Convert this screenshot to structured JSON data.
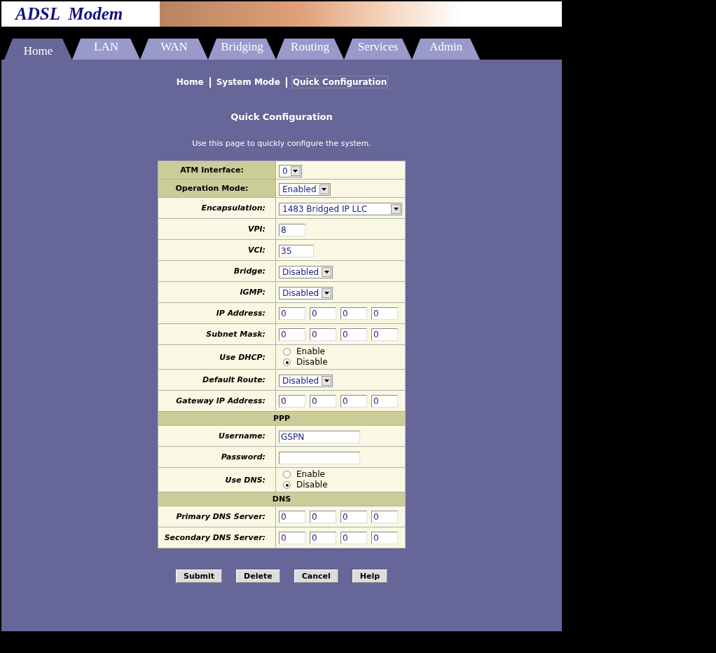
{
  "header": {
    "logo": "ADSL  Modem"
  },
  "tabs": [
    {
      "label": "Home",
      "selected": true
    },
    {
      "label": "LAN",
      "selected": false
    },
    {
      "label": "WAN",
      "selected": false
    },
    {
      "label": "Bridging",
      "selected": false
    },
    {
      "label": "Routing",
      "selected": false
    },
    {
      "label": "Services",
      "selected": false
    },
    {
      "label": "Admin",
      "selected": false
    }
  ],
  "breadcrumb": [
    {
      "label": "Home",
      "selected": false
    },
    {
      "label": "System Mode",
      "selected": false
    },
    {
      "label": "Quick Configuration",
      "selected": true
    }
  ],
  "title": "Quick Configuration",
  "description": "Use this page to quickly configure the system.",
  "rows": [
    {
      "kind": "select",
      "label": "ATM Interface:",
      "shaded": true,
      "value": "0"
    },
    {
      "kind": "select",
      "label": "Operation Mode:",
      "shaded": true,
      "value": "Enabled"
    },
    {
      "kind": "wide-select",
      "label": "Encapsulation:",
      "shaded": false,
      "value": "1483 Bridged IP LLC"
    },
    {
      "kind": "short-input",
      "label": "VPI:",
      "shaded": false,
      "value": "8"
    },
    {
      "kind": "short-input",
      "label": "VCI:",
      "shaded": false,
      "value": "35"
    },
    {
      "kind": "select",
      "label": "Bridge:",
      "shaded": false,
      "value": "Disabled"
    },
    {
      "kind": "select",
      "label": "IGMP:",
      "shaded": false,
      "value": "Disabled"
    },
    {
      "kind": "ip",
      "label": "IP Address:",
      "shaded": false,
      "octets": [
        "0",
        "0",
        "0",
        "0"
      ]
    },
    {
      "kind": "ip",
      "label": "Subnet Mask:",
      "shaded": false,
      "octets": [
        "0",
        "0",
        "0",
        "0"
      ]
    },
    {
      "kind": "radio",
      "label": "Use DHCP:",
      "shaded": false,
      "options": [
        {
          "label": "Enable",
          "selected": false
        },
        {
          "label": "Disable",
          "selected": true
        }
      ]
    },
    {
      "kind": "select",
      "label": "Default Route:",
      "shaded": false,
      "value": "Disabled"
    },
    {
      "kind": "ip",
      "label": "Gateway IP Address:",
      "shaded": false,
      "octets": [
        "0",
        "0",
        "0",
        "0"
      ]
    },
    {
      "kind": "section",
      "label": "PPP"
    },
    {
      "kind": "text-input",
      "label": "Username:",
      "shaded": false,
      "value": "GSPN"
    },
    {
      "kind": "text-input",
      "label": "Password:",
      "shaded": false
    },
    {
      "kind": "radio",
      "label": "Use DNS:",
      "shaded": false,
      "options": [
        {
          "label": "Enable",
          "selected": false
        },
        {
          "label": "Disable",
          "selected": true
        }
      ]
    },
    {
      "kind": "section",
      "label": "DNS"
    },
    {
      "kind": "ip",
      "label": "Primary DNS Server:",
      "shaded": false,
      "octets": [
        "0",
        "0",
        "0",
        "0"
      ]
    },
    {
      "kind": "ip",
      "label": "Secondary DNS Server:",
      "shaded": false,
      "octets": [
        "0",
        "0",
        "0",
        "0"
      ]
    }
  ],
  "buttons": [
    "Submit",
    "Delete",
    "Cancel",
    "Help"
  ]
}
